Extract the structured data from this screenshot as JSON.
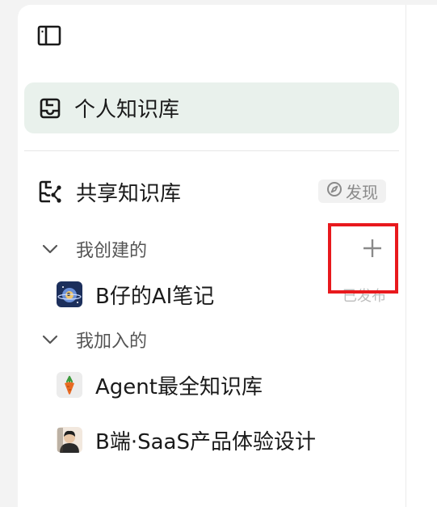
{
  "sidebar": {
    "personal_kb": {
      "label": "个人知识库"
    },
    "shared_kb": {
      "label": "共享知识库",
      "discover_label": "发现"
    },
    "groups": [
      {
        "label": "我创建的",
        "items": [
          {
            "name": "B仔的AI笔记",
            "status": "已发布",
            "avatar_icon": "planet-avatar-icon"
          }
        ]
      },
      {
        "label": "我加入的",
        "items": [
          {
            "name": "Agent最全知识库",
            "avatar_icon": "carrot-avatar-icon"
          },
          {
            "name": "B端·SaaS产品体验设计",
            "avatar_icon": "person-avatar-icon"
          }
        ]
      }
    ]
  },
  "colors": {
    "active_bg": "#e9f1ec",
    "highlight_border": "#e8191d",
    "muted_text": "#8a8a8a"
  }
}
